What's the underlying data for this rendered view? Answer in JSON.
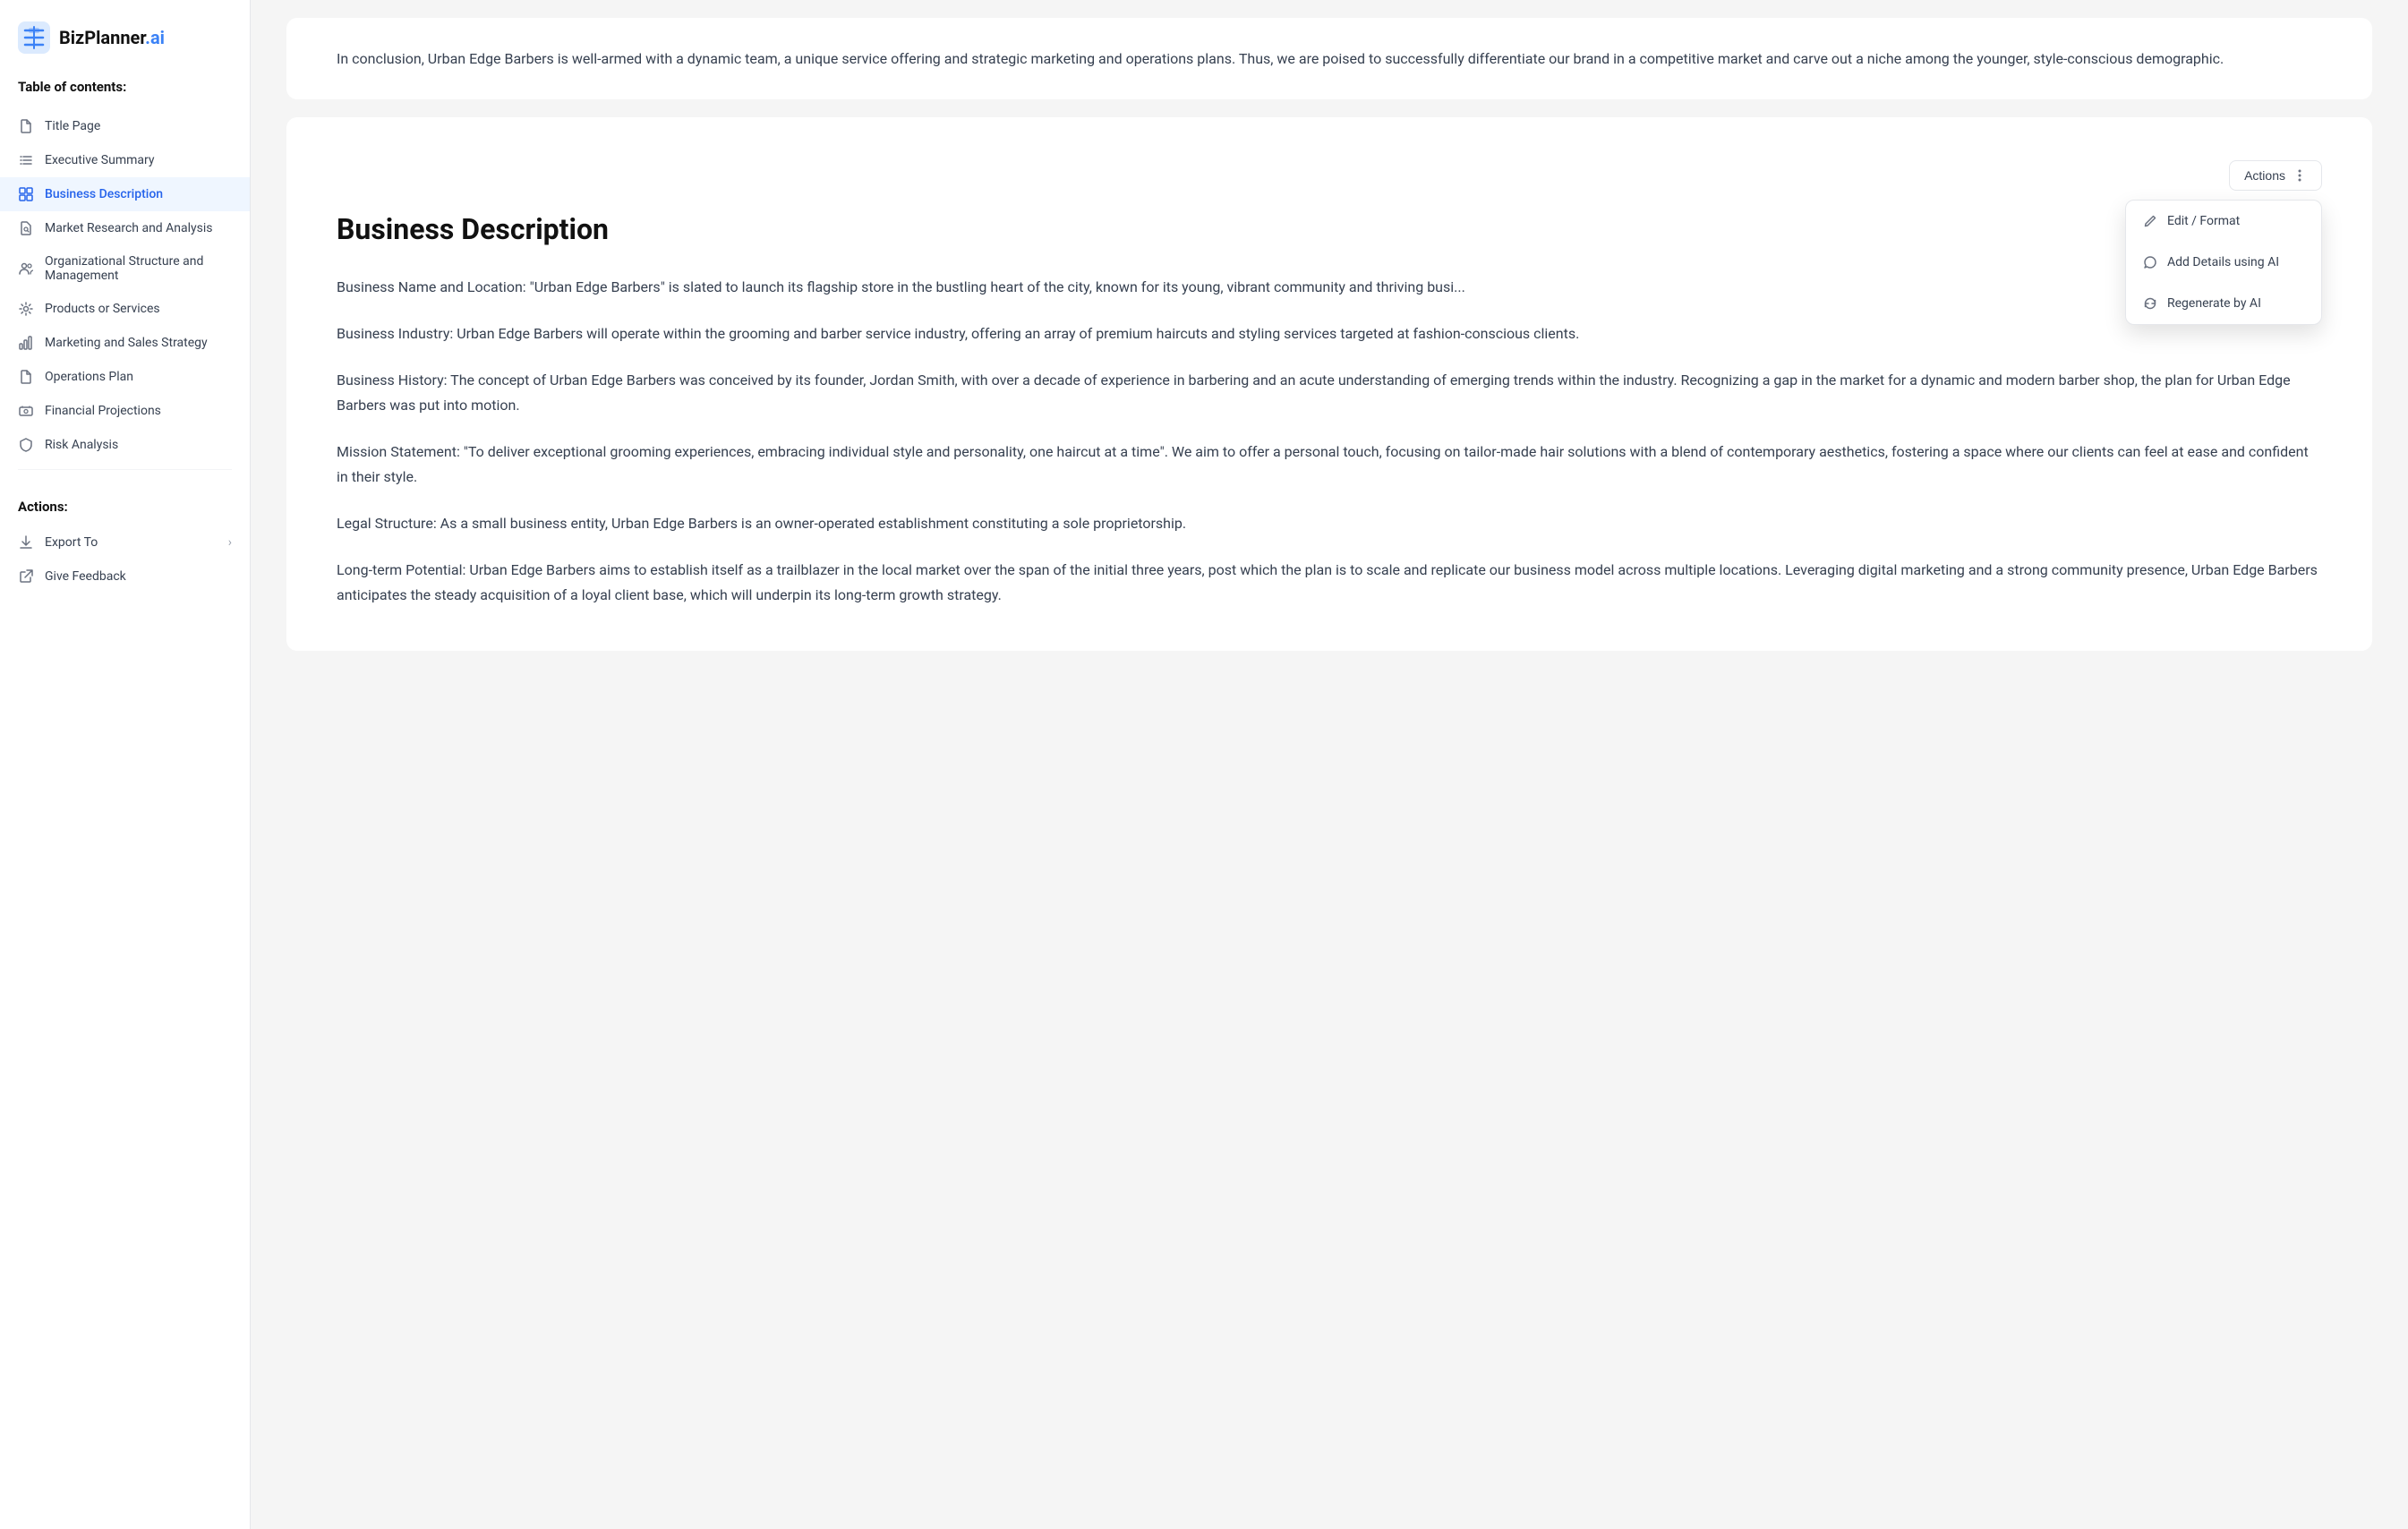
{
  "app": {
    "name": "BizPlanner",
    "name_accent": ".ai"
  },
  "sidebar": {
    "toc_label": "Table of contents:",
    "actions_label": "Actions:",
    "nav_items": [
      {
        "id": "title-page",
        "label": "Title Page",
        "icon": "file-icon",
        "active": false
      },
      {
        "id": "executive-summary",
        "label": "Executive Summary",
        "icon": "list-icon",
        "active": false
      },
      {
        "id": "business-description",
        "label": "Business Description",
        "icon": "grid-icon",
        "active": true
      },
      {
        "id": "market-research",
        "label": "Market Research and Analysis",
        "icon": "document-search-icon",
        "active": false
      },
      {
        "id": "organizational-structure",
        "label": "Organizational Structure and Management",
        "icon": "users-icon",
        "active": false
      },
      {
        "id": "products-services",
        "label": "Products or Services",
        "icon": "gear-icon",
        "active": false
      },
      {
        "id": "marketing-sales",
        "label": "Marketing and Sales Strategy",
        "icon": "chart-icon",
        "active": false
      },
      {
        "id": "operations-plan",
        "label": "Operations Plan",
        "icon": "file-icon",
        "active": false
      },
      {
        "id": "financial-projections",
        "label": "Financial Projections",
        "icon": "cash-icon",
        "active": false
      },
      {
        "id": "risk-analysis",
        "label": "Risk Analysis",
        "icon": "shield-icon",
        "active": false
      }
    ],
    "action_items": [
      {
        "id": "export-to",
        "label": "Export To",
        "has_chevron": true,
        "icon": "download-icon"
      },
      {
        "id": "give-feedback",
        "label": "Give Feedback",
        "has_chevron": false,
        "icon": "external-link-icon"
      }
    ]
  },
  "intro": {
    "text": "In conclusion, Urban Edge Barbers is well-armed with a dynamic team, a unique service offering and strategic marketing and operations plans. Thus, we are poised to successfully differentiate our brand in a competitive market and carve out a niche among the younger, style-conscious demographic."
  },
  "actions_btn_label": "Actions",
  "actions_menu": {
    "items": [
      {
        "id": "edit-format",
        "label": "Edit / Format",
        "icon": "edit-icon"
      },
      {
        "id": "add-details-ai",
        "label": "Add Details using AI",
        "icon": "chat-icon"
      },
      {
        "id": "regenerate-ai",
        "label": "Regenerate by AI",
        "icon": "refresh-icon"
      }
    ]
  },
  "section": {
    "title": "Business Description",
    "paragraphs": [
      "Business Name and Location: \"Urban Edge Barbers\" is slated to launch its flagship store in the bustling heart of the city, known for its young, vibrant community and thriving busi...",
      "Business Industry: Urban Edge Barbers will operate within the grooming and barber service industry, offering an array of premium haircuts and styling services targeted at fashion-conscious clients.",
      "Business History: The concept of Urban Edge Barbers was conceived by its founder, Jordan Smith, with over a decade of experience in barbering and an acute understanding of emerging trends within the industry. Recognizing a gap in the market for a dynamic and modern barber shop, the plan for Urban Edge Barbers was put into motion.",
      "Mission Statement: \"To deliver exceptional grooming experiences, embracing individual style and personality, one haircut at a time\". We aim to offer a personal touch, focusing on tailor-made hair solutions with a blend of contemporary aesthetics, fostering a space where our clients can feel at ease and confident in their style.",
      "Legal Structure: As a small business entity, Urban Edge Barbers is an owner-operated establishment constituting a sole proprietorship.",
      "Long-term Potential: Urban Edge Barbers aims to establish itself as a trailblazer in the local market over the span of the initial three years, post which the plan is to scale and replicate our business model across multiple locations. Leveraging digital marketing and a strong community presence, Urban Edge Barbers anticipates the steady acquisition of a loyal client base, which will underpin its long-term growth strategy."
    ]
  }
}
